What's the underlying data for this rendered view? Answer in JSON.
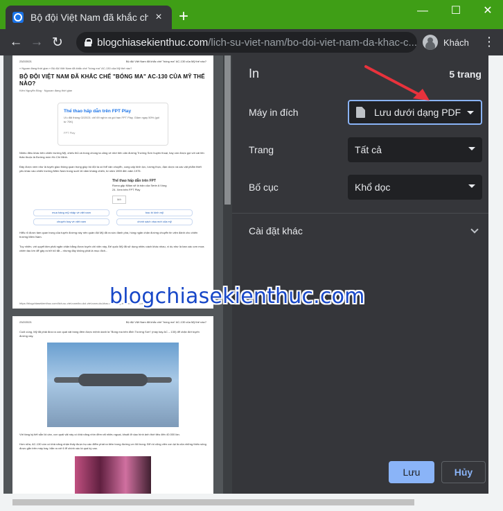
{
  "browser": {
    "tab_title": "Bộ đội Việt Nam đã khắc chế \"bó",
    "tab_close": "×",
    "new_tab": "+",
    "window_controls": {
      "minimize": "—",
      "maximize": "☐",
      "close": "✕"
    },
    "nav": {
      "back": "←",
      "forward": "→",
      "reload": "↻"
    },
    "url_host": "blogchiasekienthuc.com",
    "url_path": "/lich-su-viet-nam/bo-doi-viet-nam-da-khac-c...",
    "profile_label": "Khách",
    "menu": "⋮"
  },
  "preview": {
    "page1": {
      "date": "23/2/2021",
      "header_title": "Bộ đội Việt Nam đã khắc chế \"bóng ma\" AC-130 của Mỹ thế nào?",
      "breadcrumb": "» Ngoan đang thời gian  »  Bộ đội Việt Nam đã khắc chế \"bóng ma\" AC-130 của Mỹ thế nào?",
      "title": "BỘ ĐỘI VIỆT NAM ĐÃ KHẮC CHẾ \"BÓNG MA\" AC-130 CỦA MỸ THẾ NÀO?",
      "meta": "Kiên Nguyễn Blog  ·  Nguoan đang thời gian",
      "ad_title": "Thể thao hấp dẫn trên FPT Play",
      "ad_sub": "Ưu đãi tháng 02/2021: chỉ 69 nghìn và gói hạn FPT Play. Giảm ngay 50% (gói từ 70K)",
      "ad_foot": "FPT Play",
      "text1": "Nhiều điều khác trên chiến trường Mỹ, chiếu thủ và trong chúng ta cũng về nhờ tiến căn đường Trường Sơn huyền thoại, hay còn được gọi với cái tên thân thuộc là Đường mòn Hồ Chí Minh.",
      "text2": "Đây được xem như là tuyến giao thông quan trọng giúp bộ đội ta có thể vận chuyển, cung cấp binh lực, lương thực, đạn dược và các vật phẩm thiết yếu khác vào chiến trường Miền Nam trong suốt 16 năm kháng chiến, từ năm 1959 đến năm 1975.",
      "mini_ad_title": "Thể thao hấp dẫn trên FPT",
      "mini_ad_sub": "Roma gặp Milan sẽ là trận của Serie A Vòng 24. Xem trên FPT Play",
      "mini_ad_btn": "Mở",
      "searches": [
        "mua hàng mỹ nhập về việt nam",
        "bao bì kinh mỹ",
        "chuyến bay về việt nam",
        "chính sách visa mới của mỹ"
      ],
      "text3": "Hiểu rõ được tầm quan trọng của tuyến đường này nên quân đội Mỹ đã ra sức đánh phá, hòng ngăn chặn đường chuyển tin viện đánh cho chiến trường Miền Nam.",
      "text4": "Tuy nhiên, với quyết tâm phải ngăn chặn bằng được tuyến chi viện này, Đế quốc Mỹ đã sử dụng nhiều cách khác nhau, vì dụ như là ban các cơn mưa chiến tàu lớn để gây ra trở bỏ tắt – nhưng đây không phải là mục đích...",
      "footer_url": "https://blogchiasekienthuc.com/lich-su-viet-nam/bo-doi-viet-nam-da-khac-che-bong-ma-ac-130-cua-my.html"
    },
    "page2": {
      "date": "23/2/2021",
      "header_title": "Bộ đội Việt Nam đã khắc chế \"bóng ma\" AC-130 của Mỹ thế nào?",
      "text1": "Cuối cùng, Mỹ đã phải đưa ra con quái vật bóng đêm được mệnh danh là \"Bóng ma trên đỉnh Trường Sơn\" (máy bay AC – 130) để chặn đứt tuyến đường này.",
      "text2": "Với tầng ký tiết sẵn lồi cần, con quái vật này có khả năng nhìn đêm rất nhiều ngoại, khuất lỡ dạo hình ảnh thời tiêu đến 40.000 lần.",
      "text3": "Hơn nữa, AC-130 còn có khả năng nhận thấy được bụ các điểm phát ra tiếm trong đường vơ đối trong. Để rồi cũng viên con lại là của những thiếu sông được gắn trên máy bay, bắn ra với 6 lể chính xác là quá kỳ cao."
    }
  },
  "print_panel": {
    "title": "In",
    "page_count": "5 trang",
    "destination_label": "Máy in đích",
    "destination_value": "Lưu dưới dạng PDF",
    "pages_label": "Trang",
    "pages_value": "Tất cả",
    "layout_label": "Bố cục",
    "layout_value": "Khổ dọc",
    "more_settings_label": "Cài đặt khác",
    "save_button": "Lưu",
    "cancel_button": "Hủy"
  },
  "overlay": {
    "watermark": "blogchiasekienthuc.com",
    "arrow_color": "#e8323c"
  },
  "colors": {
    "accent": "#8ab4f8",
    "titlebar_green": "#3f9e16",
    "panel_bg": "#35363a"
  }
}
